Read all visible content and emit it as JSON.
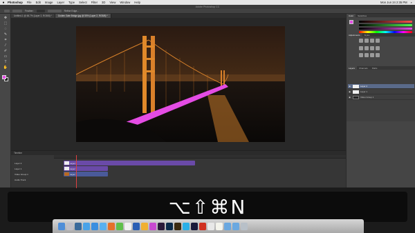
{
  "menubar": {
    "apple_icon": "apple-icon",
    "app_name": "Photoshop",
    "items": [
      "File",
      "Edit",
      "Image",
      "Layer",
      "Type",
      "Select",
      "Filter",
      "3D",
      "View",
      "Window",
      "Help"
    ],
    "clock": "Mon Jun 24 2:35 PM"
  },
  "window": {
    "title": "Adobe Photoshop CC"
  },
  "options": {
    "label1": "Feather:",
    "label2": "Refine Edge..."
  },
  "tabs": [
    {
      "label": "Untitled-1 @ 66.7% (Layer 2, RGB/8) *"
    },
    {
      "label": "Golden Gate Bridge.jpg @ 50% (Layer 2, RGB/8) *"
    }
  ],
  "colors": {
    "foreground": "#e44ce4",
    "background": "#111111",
    "accent": "#e44ce4",
    "clip_purple": "#6a4aa8",
    "clip_blue": "#4a5a9a"
  },
  "panels": {
    "color_tabs": [
      "Color",
      "Swatches"
    ],
    "adjust_tabs": [
      "Adjustments",
      "Styles"
    ],
    "layers_tabs": [
      "Layers",
      "Channels",
      "Paths"
    ],
    "layers": [
      {
        "name": "Layer 2",
        "selected": true
      },
      {
        "name": "Layer 1",
        "selected": false
      },
      {
        "name": "Video Group 1",
        "selected": false
      }
    ]
  },
  "timeline": {
    "title": "Timeline",
    "tracks": [
      "Layer 2",
      "Layer 1",
      "Video Group 1",
      "Audio Track"
    ],
    "clips": [
      "Layer 2",
      "Layer 1",
      "Layer 1"
    ]
  },
  "overlay": {
    "shortcut": "⌥⇧⌘N"
  },
  "dock": {
    "icons": [
      "finder-icon",
      "launchpad-icon",
      "mission-control-icon",
      "app-store-icon",
      "safari-icon",
      "mail-icon",
      "firefox-icon",
      "chrome-icon",
      "calendar-icon",
      "word-icon",
      "photos-icon",
      "itunes-icon",
      "premiere-icon",
      "photoshop-icon",
      "illustrator-icon",
      "skype-icon",
      "media-encoder-icon",
      "acrobat-icon",
      "preview-icon",
      "textedit-icon",
      "folder-icon",
      "folder-icon",
      "trash-icon"
    ]
  }
}
